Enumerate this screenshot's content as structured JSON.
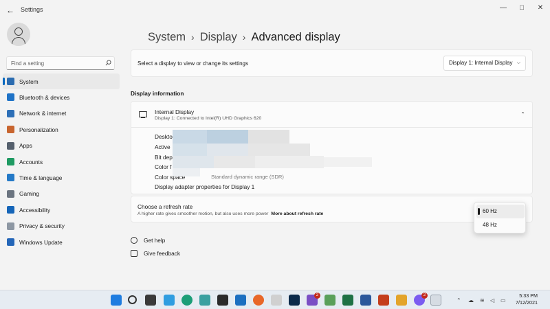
{
  "window": {
    "title": "Settings",
    "back": "←",
    "controls": {
      "minimize": "—",
      "maximize": "□",
      "close": "✕"
    }
  },
  "search": {
    "placeholder": "Find a setting"
  },
  "sidebar": {
    "items": [
      {
        "label": "System",
        "icon": "system-icon",
        "color": "#2b6cb0"
      },
      {
        "label": "Bluetooth & devices",
        "icon": "bluetooth-icon",
        "color": "#1f73c7"
      },
      {
        "label": "Network & internet",
        "icon": "network-icon",
        "color": "#2d6fb7"
      },
      {
        "label": "Personalization",
        "icon": "brush-icon",
        "color": "#c8652f"
      },
      {
        "label": "Apps",
        "icon": "apps-icon",
        "color": "#55606d"
      },
      {
        "label": "Accounts",
        "icon": "accounts-icon",
        "color": "#1e9a62"
      },
      {
        "label": "Time & language",
        "icon": "globe-clock-icon",
        "color": "#2479c7"
      },
      {
        "label": "Gaming",
        "icon": "controller-icon",
        "color": "#6b7480"
      },
      {
        "label": "Accessibility",
        "icon": "accessibility-icon",
        "color": "#1565b8"
      },
      {
        "label": "Privacy & security",
        "icon": "shield-icon",
        "color": "#8d97a3"
      },
      {
        "label": "Windows Update",
        "icon": "update-icon",
        "color": "#2466b8"
      }
    ],
    "active_index": 0
  },
  "breadcrumb": {
    "root": "System",
    "middle": "Display",
    "current": "Advanced display",
    "separator": "›"
  },
  "display_select": {
    "prompt": "Select a display to view or change its settings",
    "value": "Display 1: Internal Display",
    "chevron": "⌵"
  },
  "display_info": {
    "section_title": "Display information",
    "name": "Internal Display",
    "subtitle": "Display 1: Connected to Intel(R) UHD Graphics 620",
    "collapse": "⌃",
    "rows": [
      {
        "label": "Deskto",
        "value": ""
      },
      {
        "label": "Active",
        "value": ""
      },
      {
        "label": "Bit dep",
        "value": ""
      },
      {
        "label": "Color f",
        "value": ""
      },
      {
        "label": "Color space",
        "value": "Standard dynamic range (SDR)"
      },
      {
        "label": "Display adapter properties for Display 1",
        "value": ""
      }
    ]
  },
  "refresh_rate": {
    "title": "Choose a refresh rate",
    "description": "A higher rate gives smoother motion, but also uses more power",
    "link": "More about refresh rate",
    "options": [
      "60 Hz",
      "48 Hz"
    ],
    "selected": "60 Hz"
  },
  "help_links": {
    "get_help": "Get help",
    "feedback": "Give feedback"
  },
  "taskbar": {
    "badges": {
      "news": "2",
      "messenger": "2"
    },
    "time": "5:33 PM",
    "date": "7/12/2021"
  },
  "colors": {
    "accent": "#0067c0",
    "badge": "#c42b1c"
  }
}
